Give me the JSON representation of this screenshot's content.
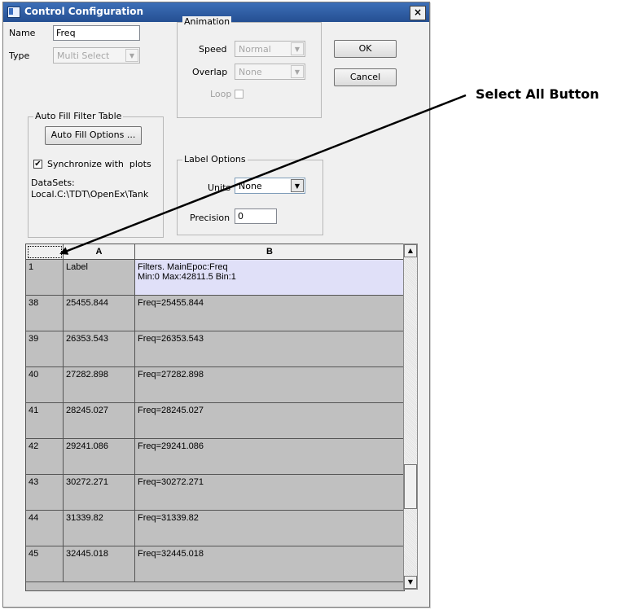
{
  "window": {
    "title": "Control Configuration",
    "close_glyph": "×"
  },
  "form": {
    "name_label": "Name",
    "name_value": "Freq",
    "type_label": "Type",
    "type_value": "Multi Select"
  },
  "animation": {
    "caption": "Animation",
    "speed_label": "Speed",
    "speed_value": "Normal",
    "overlap_label": "Overlap",
    "overlap_value": "None",
    "loop_label": "Loop"
  },
  "buttons": {
    "ok": "OK",
    "cancel": "Cancel"
  },
  "auto_fill": {
    "caption": "Auto Fill Filter Table",
    "options_button": "Auto Fill Options ...",
    "sync_label": "Synchronize with  plots",
    "sync_checked": "✔",
    "datasets_label": "DataSets:",
    "datasets_value": "Local.C:\\TDT\\OpenEx\\Tank"
  },
  "label_options": {
    "caption": "Label Options",
    "units_label": "Units",
    "units_value": "None",
    "precision_label": "Precision",
    "precision_value": "0"
  },
  "table": {
    "columns": [
      "A",
      "B"
    ],
    "rows": [
      {
        "num": "1",
        "a": "Label",
        "b1": "Filters. MainEpoc:Freq",
        "b2": "Min:0  Max:42811.5  Bin:1"
      },
      {
        "num": "38",
        "a": "25455.844",
        "b1": "Freq=25455.844",
        "b2": ""
      },
      {
        "num": "39",
        "a": "26353.543",
        "b1": "Freq=26353.543",
        "b2": ""
      },
      {
        "num": "40",
        "a": "27282.898",
        "b1": "Freq=27282.898",
        "b2": ""
      },
      {
        "num": "41",
        "a": "28245.027",
        "b1": "Freq=28245.027",
        "b2": ""
      },
      {
        "num": "42",
        "a": "29241.086",
        "b1": "Freq=29241.086",
        "b2": ""
      },
      {
        "num": "43",
        "a": "30272.271",
        "b1": "Freq=30272.271",
        "b2": ""
      },
      {
        "num": "44",
        "a": "31339.82",
        "b1": "Freq=31339.82",
        "b2": ""
      },
      {
        "num": "45",
        "a": "32445.018",
        "b1": "Freq=32445.018",
        "b2": ""
      }
    ]
  },
  "annotation": {
    "text": "Select All Button"
  },
  "colors": {
    "title_bar": "#2c5aa0",
    "label_row": "#e0e0f8",
    "grid_bg": "#c0c0c0"
  }
}
